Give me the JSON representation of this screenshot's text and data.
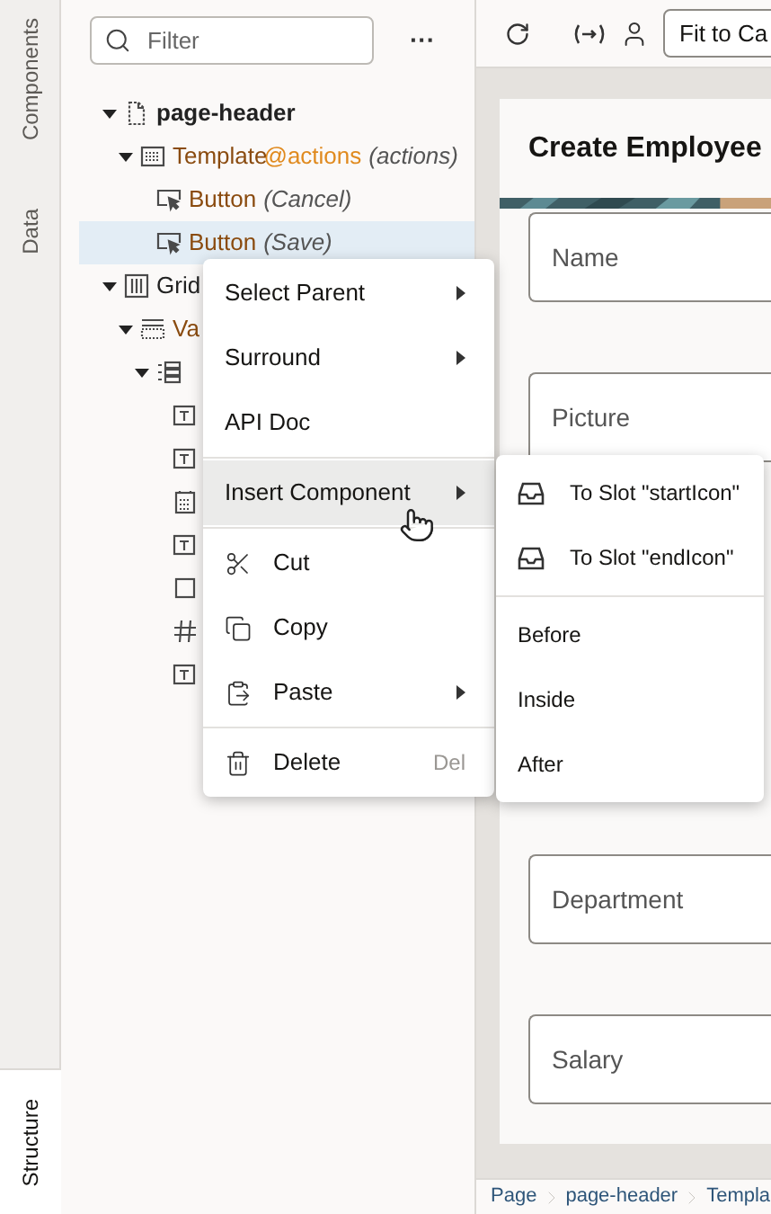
{
  "side_tabs": [
    {
      "label": "Components",
      "selected": false
    },
    {
      "label": "Data",
      "selected": false
    },
    {
      "label": "Structure",
      "selected": true
    }
  ],
  "structure": {
    "filter": {
      "placeholder": "Filter"
    },
    "more": "···",
    "tree": [
      {
        "kind": "page",
        "label": "page-header",
        "selected": false,
        "expanded": true,
        "children": [
          {
            "kind": "template",
            "label": "Template",
            "slot": "@actions",
            "note": "(actions)",
            "selected": false,
            "expanded": true,
            "children": [
              {
                "kind": "button",
                "label": "Button",
                "note": "(Cancel)",
                "selected": false
              },
              {
                "kind": "button",
                "label": "Button",
                "note": "(Save)",
                "selected": true
              }
            ]
          }
        ]
      },
      {
        "kind": "grid",
        "label": "Grid",
        "selected": false,
        "expanded": true,
        "children": [
          {
            "kind": "vertical",
            "label": "Va",
            "selected": false,
            "expanded": true,
            "children": [
              {
                "kind": "list",
                "selected": false,
                "expanded": true,
                "children": [
                  {
                    "kind": "text",
                    "selected": false
                  },
                  {
                    "kind": "text",
                    "selected": false
                  },
                  {
                    "kind": "date",
                    "selected": false
                  },
                  {
                    "kind": "text",
                    "selected": false
                  },
                  {
                    "kind": "checkbox",
                    "selected": false
                  },
                  {
                    "kind": "number",
                    "selected": false
                  },
                  {
                    "kind": "text",
                    "selected": false
                  }
                ]
              }
            ]
          }
        ]
      }
    ]
  },
  "toolbar": {
    "fit_button": "Fit to Ca"
  },
  "canvas": {
    "title": "Create Employee",
    "fields": [
      {
        "label": "Name"
      },
      {
        "label": "Picture"
      },
      {
        "label": "Department"
      },
      {
        "label": "Salary"
      }
    ]
  },
  "breadcrumb": [
    {
      "label": "Page"
    },
    {
      "label": "page-header"
    },
    {
      "label": "Templa"
    }
  ],
  "context_menu": {
    "sections": [
      [
        {
          "kind": "plain",
          "label": "Select Parent",
          "submenu": true,
          "selected": false
        },
        {
          "kind": "plain",
          "label": "Surround",
          "submenu": true,
          "selected": false
        },
        {
          "kind": "plain",
          "label": "API Doc",
          "submenu": false,
          "selected": false
        }
      ],
      [
        {
          "kind": "plain",
          "label": "Insert Component",
          "submenu": true,
          "selected": true
        }
      ],
      [
        {
          "kind": "cut",
          "label": "Cut",
          "submenu": false,
          "selected": false
        },
        {
          "kind": "copy",
          "label": "Copy",
          "submenu": false,
          "selected": false
        },
        {
          "kind": "paste",
          "label": "Paste",
          "submenu": true,
          "selected": false
        }
      ],
      [
        {
          "kind": "delete",
          "label": "Delete",
          "shortcut": "Del",
          "submenu": false,
          "selected": false
        }
      ]
    ]
  },
  "submenu": {
    "sections": [
      [
        {
          "kind": "slot",
          "label": "To Slot \"startIcon\""
        },
        {
          "kind": "slot",
          "label": "To Slot \"endIcon\""
        }
      ],
      [
        {
          "kind": "plain",
          "label": "Before"
        },
        {
          "kind": "plain",
          "label": "Inside"
        },
        {
          "kind": "plain",
          "label": "After"
        }
      ]
    ]
  }
}
